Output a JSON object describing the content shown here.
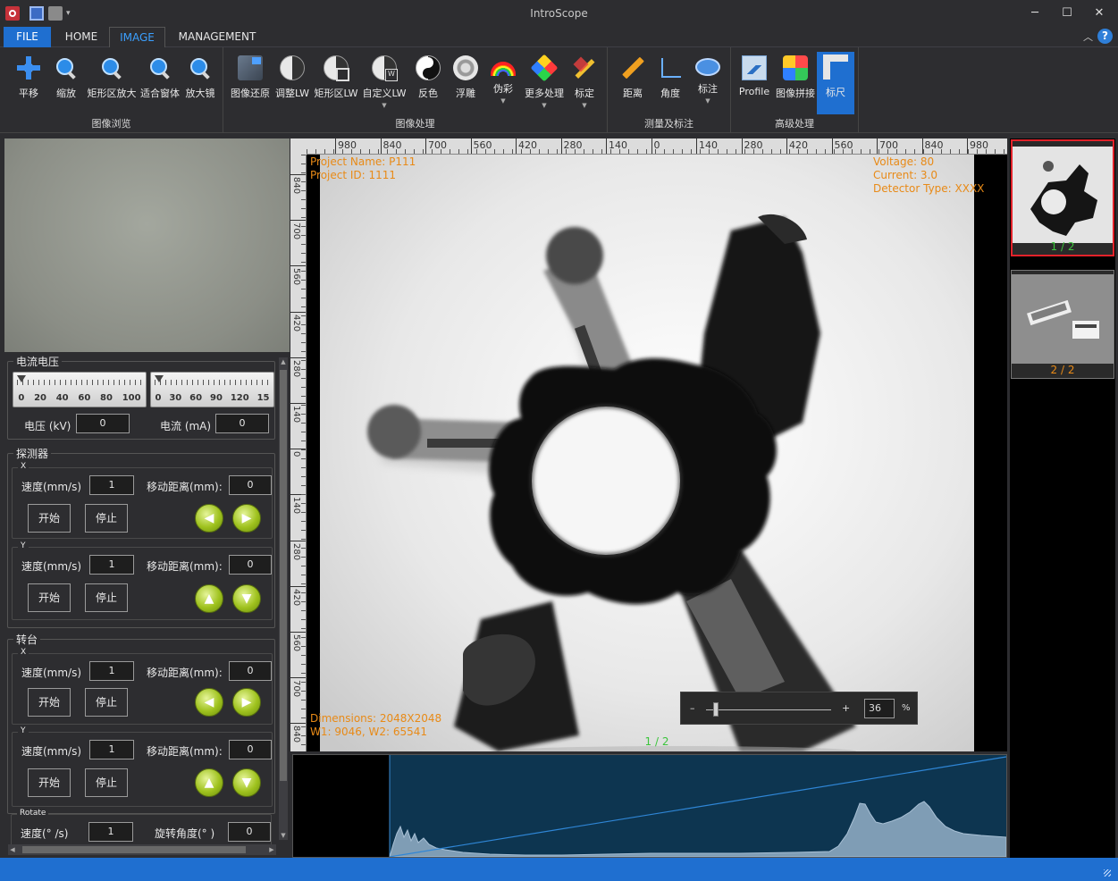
{
  "window": {
    "title": "IntroScope"
  },
  "tabs": [
    {
      "label": "FILE"
    },
    {
      "label": "HOME"
    },
    {
      "label": "IMAGE"
    },
    {
      "label": "MANAGEMENT"
    }
  ],
  "ribbon": {
    "browse": {
      "label": "图像浏览",
      "buttons": [
        {
          "label": "平移",
          "icon": "pan-icon"
        },
        {
          "label": "缩放",
          "icon": "zoom-icon"
        },
        {
          "label": "矩形区放大",
          "icon": "rect-zoom-icon"
        },
        {
          "label": "适合窗体",
          "icon": "fit-window-icon"
        },
        {
          "label": "放大镜",
          "icon": "magnifier-icon"
        }
      ]
    },
    "process": {
      "label": "图像处理",
      "buttons": [
        {
          "label": "图像还原",
          "icon": "restore-icon"
        },
        {
          "label": "调整LW",
          "icon": "adjust-lw-icon"
        },
        {
          "label": "矩形区LW",
          "icon": "rect-lw-icon"
        },
        {
          "label": "自定义LW",
          "icon": "custom-lw-icon"
        },
        {
          "label": "反色",
          "icon": "invert-icon"
        },
        {
          "label": "浮雕",
          "icon": "emboss-icon"
        },
        {
          "label": "伪彩",
          "icon": "pseudocolor-icon"
        },
        {
          "label": "更多处理",
          "icon": "more-processing-icon"
        },
        {
          "label": "标定",
          "icon": "calibrate-icon"
        }
      ]
    },
    "measure": {
      "label": "测量及标注",
      "buttons": [
        {
          "label": "距离",
          "icon": "distance-icon"
        },
        {
          "label": "角度",
          "icon": "angle-icon"
        },
        {
          "label": "标注",
          "icon": "annotate-icon"
        }
      ]
    },
    "advanced": {
      "label": "高级处理",
      "buttons": [
        {
          "label": "Profile",
          "icon": "profile-icon"
        },
        {
          "label": "图像拼接",
          "icon": "stitch-icon"
        },
        {
          "label": "标尺",
          "icon": "scale-ruler-icon"
        }
      ]
    }
  },
  "controls": {
    "power": {
      "title": "电流电压",
      "voltage_scale": [
        "0",
        "20",
        "40",
        "60",
        "80",
        "100"
      ],
      "current_scale": [
        "0",
        "30",
        "60",
        "90",
        "120",
        "15"
      ],
      "voltage_label": "电压 (kV)",
      "voltage_value": "0",
      "current_label": "电流 (mA)",
      "current_value": "0"
    },
    "detector": {
      "title": "探测器",
      "x": {
        "title": "X",
        "speed_label": "速度(mm/s)",
        "speed": "1",
        "dist_label": "移动距离(mm):",
        "dist": "0"
      },
      "y": {
        "title": "Y",
        "speed_label": "速度(mm/s)",
        "speed": "1",
        "dist_label": "移动距离(mm):",
        "dist": "0"
      }
    },
    "stage": {
      "title": "转台",
      "x": {
        "title": "X",
        "speed_label": "速度(mm/s)",
        "speed": "1",
        "dist_label": "移动距离(mm):",
        "dist": "0"
      },
      "y": {
        "title": "Y",
        "speed_label": "速度(mm/s)",
        "speed": "1",
        "dist_label": "移动距离(mm):",
        "dist": "0"
      }
    },
    "rotate": {
      "title": "Rotate",
      "speed_label": "速度(° /s)",
      "speed": "1",
      "angle_label": "旋转角度(° )",
      "angle": "0"
    },
    "start_label": "开始",
    "stop_label": "停止"
  },
  "viewer": {
    "ruler_h": [
      "980",
      "840",
      "700",
      "560",
      "420",
      "280",
      "140",
      "0",
      "140",
      "280",
      "420",
      "560",
      "700",
      "840",
      "980"
    ],
    "ruler_v": [
      "840",
      "700",
      "560",
      "420",
      "280",
      "140",
      "0",
      "140",
      "280",
      "420",
      "560",
      "700",
      "840"
    ],
    "project_name": "Project Name: P111",
    "project_id": "Project ID: 1111",
    "voltage": "Voltage: 80",
    "current": "Current: 3.0",
    "detector_type": "Detector Type: XXXX",
    "dimensions": "Dimensions: 2048X2048",
    "window_levels": "W1: 9046, W2: 65541",
    "page": "1 / 2",
    "zoom": {
      "minus": "–",
      "plus": "+",
      "value": "36",
      "unit": "%"
    }
  },
  "thumbnails": [
    {
      "label": "1 / 2"
    },
    {
      "label": "2 / 2"
    }
  ],
  "colors": {
    "accent": "#1f6fd0",
    "overlay_text": "#e88a17",
    "page_green": "#3cc43c",
    "selected_thumb": "#e2222a"
  }
}
